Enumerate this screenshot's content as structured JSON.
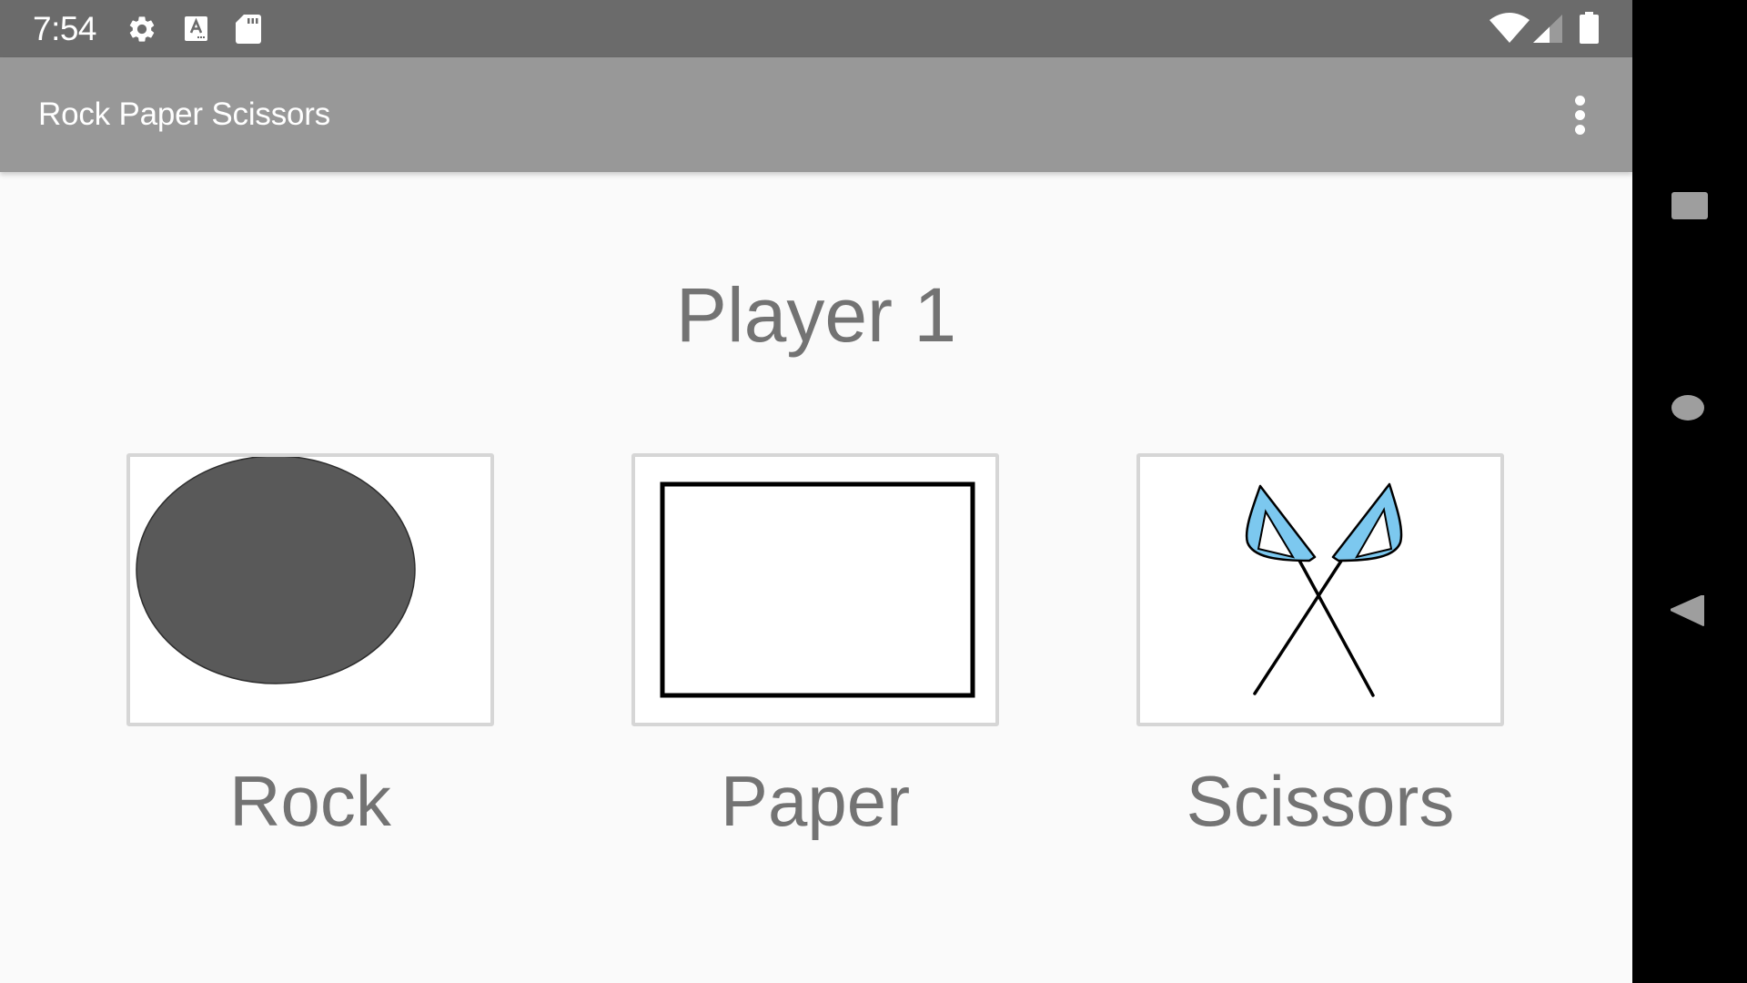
{
  "status_bar": {
    "time": "7:54",
    "left_icons": [
      "gear-icon",
      "text-a-icon",
      "sd-card-icon"
    ],
    "right_icons": [
      "wifi-icon",
      "signal-icon",
      "battery-icon"
    ]
  },
  "app_bar": {
    "title": "Rock Paper Scissors",
    "overflow_icon": "more-vert-icon"
  },
  "main": {
    "player_title": "Player 1",
    "choices": [
      {
        "id": "rock",
        "label": "Rock",
        "image": "dark-gray-ellipse"
      },
      {
        "id": "paper",
        "label": "Paper",
        "image": "outlined-rectangle"
      },
      {
        "id": "scissors",
        "label": "Scissors",
        "image": "blue-handled-scissors"
      }
    ]
  },
  "nav_bar": {
    "buttons": [
      "recents-square-icon",
      "home-circle-icon",
      "back-triangle-icon"
    ]
  },
  "colors": {
    "status_bar_bg": "#6b6b6b",
    "app_bar_bg": "#989898",
    "content_bg": "#fafafa",
    "text_gray": "#737373",
    "card_border": "#d6d6d6",
    "rock_fill": "#595959",
    "scissors_handle": "#7cc8ef",
    "nav_icon": "#9e9e9e"
  }
}
